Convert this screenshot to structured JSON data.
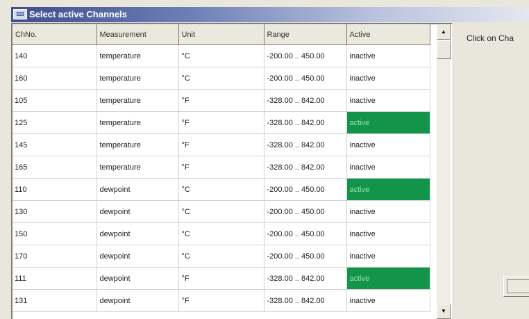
{
  "window": {
    "title": "Select active Channels"
  },
  "grid": {
    "columns": [
      "ChNo.",
      "Measurement",
      "Unit",
      "Range",
      "Active"
    ],
    "rows": [
      {
        "ch": "140",
        "measurement": "temperature",
        "unit": "°C",
        "range": "-200.00 .. 450.00",
        "active": "inactive"
      },
      {
        "ch": "160",
        "measurement": "temperature",
        "unit": "°C",
        "range": "-200.00 .. 450.00",
        "active": "inactive"
      },
      {
        "ch": "105",
        "measurement": "temperature",
        "unit": "°F",
        "range": "-328.00 .. 842.00",
        "active": "inactive"
      },
      {
        "ch": "125",
        "measurement": "temperature",
        "unit": "°F",
        "range": "-328.00 .. 842.00",
        "active": "active"
      },
      {
        "ch": "145",
        "measurement": "temperature",
        "unit": "°F",
        "range": "-328.00 .. 842.00",
        "active": "inactive"
      },
      {
        "ch": "165",
        "measurement": "temperature",
        "unit": "°F",
        "range": "-328.00 .. 842.00",
        "active": "inactive"
      },
      {
        "ch": "110",
        "measurement": "dewpoint",
        "unit": "°C",
        "range": "-200.00 .. 450.00",
        "active": "active"
      },
      {
        "ch": "130",
        "measurement": "dewpoint",
        "unit": "°C",
        "range": "-200.00 .. 450.00",
        "active": "inactive"
      },
      {
        "ch": "150",
        "measurement": "dewpoint",
        "unit": "°C",
        "range": "-200.00 .. 450.00",
        "active": "inactive"
      },
      {
        "ch": "170",
        "measurement": "dewpoint",
        "unit": "°C",
        "range": "-200.00 .. 450.00",
        "active": "inactive"
      },
      {
        "ch": "111",
        "measurement": "dewpoint",
        "unit": "°F",
        "range": "-328.00 .. 842.00",
        "active": "active"
      },
      {
        "ch": "131",
        "measurement": "dewpoint",
        "unit": "°F",
        "range": "-328.00 .. 842.00",
        "active": "inactive"
      }
    ]
  },
  "side_panel": {
    "hint": "Click on Cha"
  },
  "scrollbar": {
    "up_icon": "scroll-up-arrow-icon",
    "down_icon": "scroll-down-arrow-icon"
  },
  "colors": {
    "active_cell": "#12944a",
    "title_bar": "#3e4e8f"
  }
}
